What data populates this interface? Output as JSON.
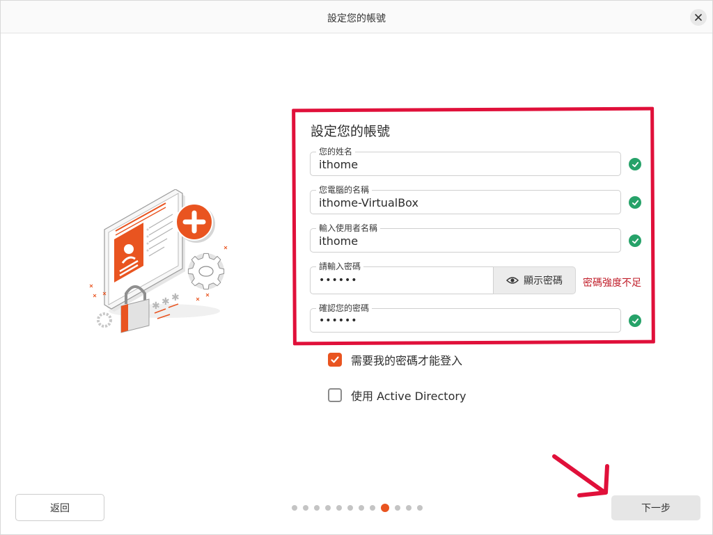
{
  "window": {
    "title": "設定您的帳號"
  },
  "form": {
    "heading": "設定您的帳號",
    "name_label": "您的姓名",
    "name_value": "ithome",
    "computer_label": "您電腦的名稱",
    "computer_value": "ithome-VirtualBox",
    "username_label": "輸入使用者名稱",
    "username_value": "ithome",
    "password_label": "請輸入密碼",
    "password_value": "••••••",
    "show_password_label": "顯示密碼",
    "password_strength": "密碼強度不足",
    "confirm_label": "確認您的密碼",
    "confirm_value": "••••••"
  },
  "options": {
    "require_password_label": "需要我的密碼才能登入",
    "require_password_checked": true,
    "active_directory_label": "使用 Active Directory",
    "active_directory_checked": false
  },
  "nav": {
    "back_label": "返回",
    "next_label": "下一步",
    "total_steps": 12,
    "current_step": 9
  },
  "colors": {
    "accent": "#e95420",
    "success": "#26a269",
    "error": "#c01c28",
    "annotation": "#e0103a"
  },
  "icons": {
    "close": "close-icon",
    "eye": "eye-icon",
    "check": "check-icon"
  }
}
